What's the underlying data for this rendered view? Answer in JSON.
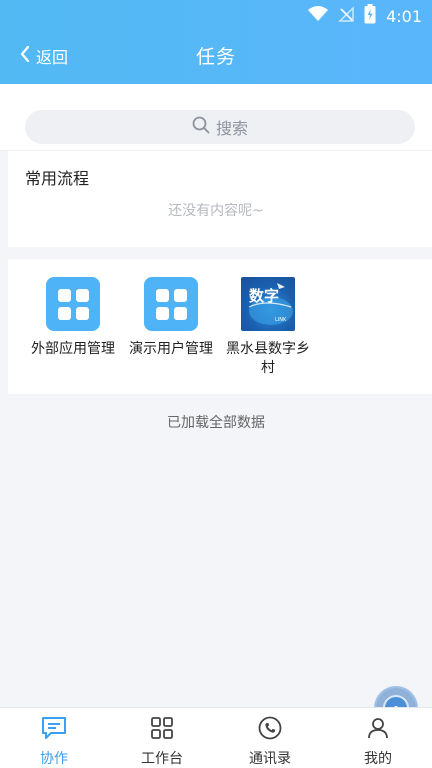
{
  "status_bar": {
    "time": "4:01"
  },
  "header": {
    "back_label": "返回",
    "title": "任务"
  },
  "search": {
    "placeholder": "搜索"
  },
  "common_process": {
    "title": "常用流程",
    "empty_text": "还没有内容呢~"
  },
  "apps": [
    {
      "label": "外部应用管理",
      "icon": "grid-apps-icon"
    },
    {
      "label": "演示用户管理",
      "icon": "grid-apps-icon"
    },
    {
      "label": "黑水县数字乡村",
      "icon": "digital-link-logo",
      "logo_text": "数字",
      "logo_subtext": "LINK"
    }
  ],
  "footer_note": "已加载全部数据",
  "bottom_nav": [
    {
      "label": "协作",
      "icon": "chat-icon",
      "active": true
    },
    {
      "label": "工作台",
      "icon": "grid-icon",
      "active": false
    },
    {
      "label": "通讯录",
      "icon": "phone-icon",
      "active": false
    },
    {
      "label": "我的",
      "icon": "user-icon",
      "active": false
    }
  ],
  "colors": {
    "primary": "#4fb3f7",
    "active_nav": "#3a9ff0"
  }
}
